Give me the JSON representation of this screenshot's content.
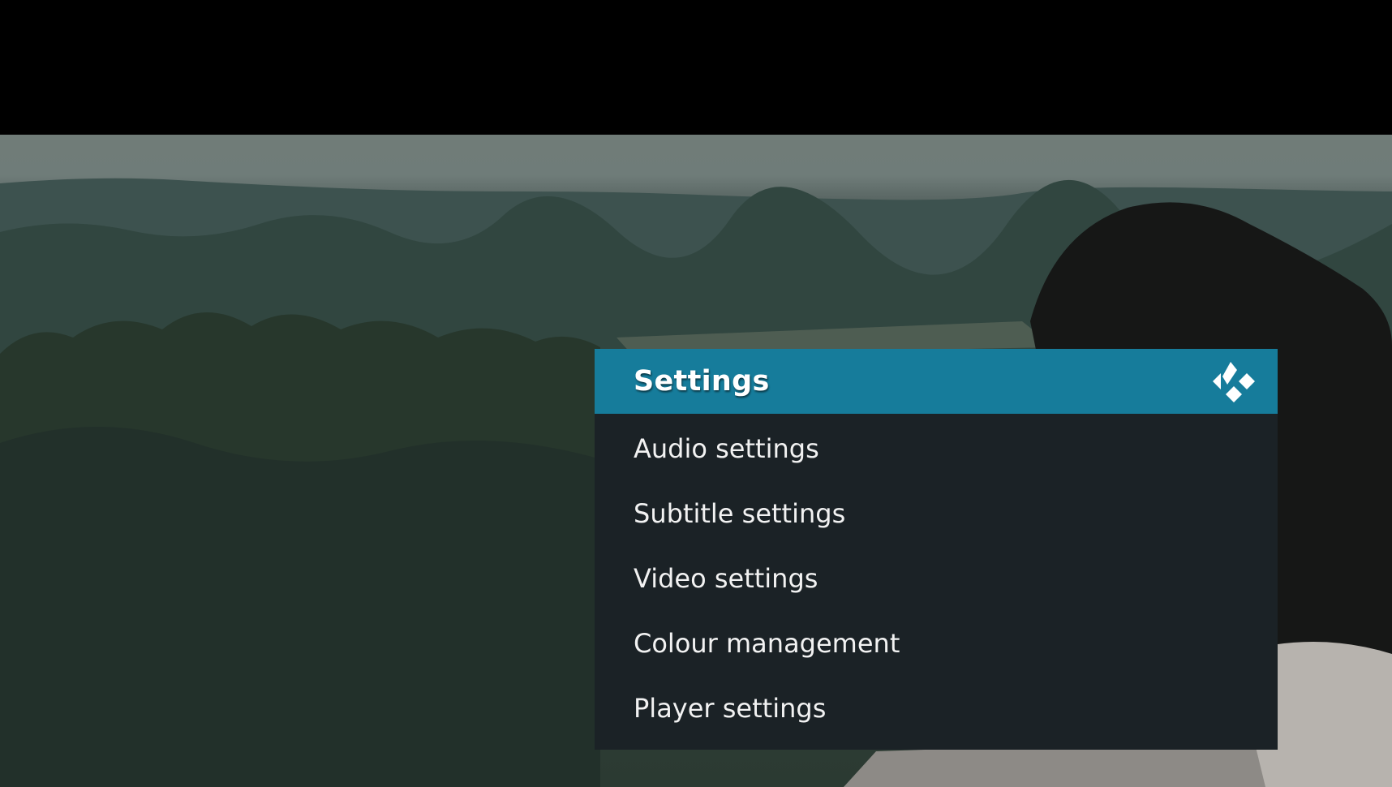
{
  "dialog": {
    "title": "Settings",
    "logo_icon": "kodi-logo-icon",
    "header_color": "#167c9b",
    "body_color": "#1b2226"
  },
  "menu": {
    "items": [
      {
        "label": "Audio settings"
      },
      {
        "label": "Subtitle settings"
      },
      {
        "label": "Video settings"
      },
      {
        "label": "Colour management"
      },
      {
        "label": "Player settings"
      }
    ]
  }
}
